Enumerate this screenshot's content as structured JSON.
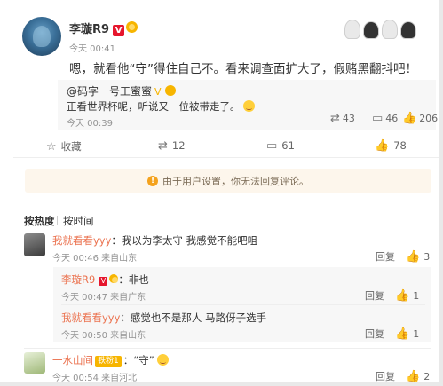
{
  "post": {
    "author": "李璇R9",
    "time": "今天 00:41",
    "text": "嗯，就看他“守”得住自己不。看来调查面扩大了，假赌黑翻抖吧！"
  },
  "quote": {
    "author": "@码字一号工蜜蜜",
    "text": "正看世界杯呢，听说又一位被带走了。",
    "time": "今天 00:39",
    "reposts": "43",
    "comments": "46",
    "likes": "206"
  },
  "stats": {
    "favorite_label": "收藏",
    "reposts": "12",
    "comments": "61",
    "likes": "78"
  },
  "notice": {
    "text": "由于用户设置，你无法回复评论。"
  },
  "sort_tabs": {
    "by_hot": "按热度",
    "by_time": "按时间"
  },
  "comments": [
    {
      "name": "我就看看yyy",
      "text": "：我以为李太守 我感觉不能吧咀",
      "time": "今天 00:46 来自山东",
      "reply_label": "回复",
      "likes": "3"
    },
    {
      "name": "李璇R9",
      "text": "：非也",
      "time": "今天 00:47 来自广东",
      "reply_label": "回复",
      "likes": "1"
    },
    {
      "name": "我就看看yyy",
      "text": "：感觉也不是那人 马路伢子选手",
      "time": "今天 00:50 来自山东",
      "reply_label": "回复",
      "likes": "1"
    },
    {
      "name": "一水山间",
      "tag": "铁粉1",
      "text": "：“守”",
      "time": "今天 00:54 来自河北",
      "reply_label": "回复",
      "likes": "2"
    }
  ],
  "colors": {
    "name_orange": "#eb7350",
    "verified_red": "#e6162d",
    "notice_bg": "#fdf6ec",
    "notice_icon": "#f4a21d"
  },
  "icons": [
    "verified-icon",
    "medal-icon",
    "repost-icon",
    "comment-icon",
    "like-icon",
    "star-icon",
    "warning-icon",
    "emoji-icon"
  ]
}
